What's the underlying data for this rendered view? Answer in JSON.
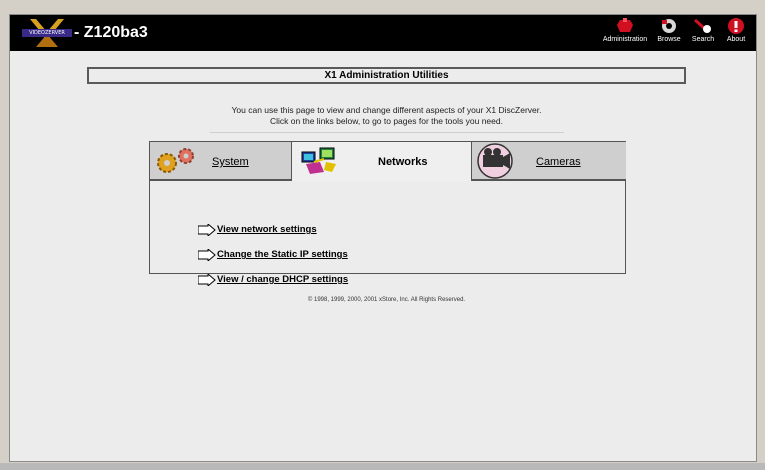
{
  "header": {
    "logo_text": "VIDEOZERVER",
    "server_name": "- Z120ba3",
    "nav": [
      {
        "label": "Administration",
        "icon": "administration-icon",
        "color": "#d01020"
      },
      {
        "label": "Browse",
        "icon": "browse-icon",
        "color": "#d8d8d8"
      },
      {
        "label": "Search",
        "icon": "search-icon",
        "color": "#d01020"
      },
      {
        "label": "About",
        "icon": "about-icon",
        "color": "#d01020"
      }
    ]
  },
  "main": {
    "title": "X1 Administration Utilities",
    "intro_line1": "You can use this page to view and change different aspects of your X1 DiscZerver.",
    "intro_line2": "Click on the links below, to go to pages for the tools you need.",
    "tabs": [
      {
        "label": "System",
        "icon": "gears-icon",
        "selected": false
      },
      {
        "label": "Networks",
        "icon": "network-computers-icon",
        "selected": true
      },
      {
        "label": "Cameras",
        "icon": "video-camera-icon",
        "selected": false
      }
    ],
    "links": [
      {
        "label": "View network settings"
      },
      {
        "label": "Change the Static IP settings"
      },
      {
        "label": "View / change DHCP settings"
      }
    ],
    "copyright": "© 1998, 1999, 2000, 2001 xStore, Inc. All Rights Reserved."
  },
  "colors": {
    "header_bg": "#000000",
    "page_bg": "#ececec",
    "accent_red": "#d01020"
  }
}
